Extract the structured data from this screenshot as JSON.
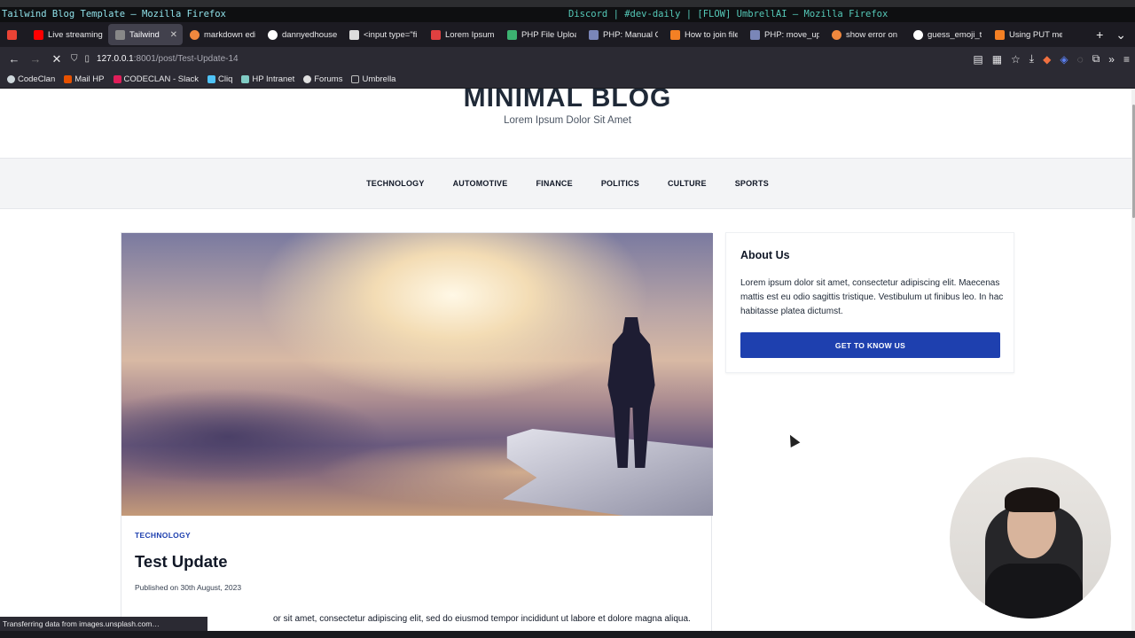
{
  "wm": {
    "left_title": "Tailwind Blog Template — Mozilla Firefox",
    "right_title": "Discord | #dev-daily | [FLOW] UmbrellAI — Mozilla Firefox"
  },
  "tabs": [
    {
      "label": "",
      "color": "#ea4335",
      "icon": "gmail-icon"
    },
    {
      "label": "Live streaming",
      "color": "#ff0000",
      "icon": "youtube-icon"
    },
    {
      "label": "Tailwind Blo",
      "color": "#888888",
      "icon": "page-icon",
      "active": true
    },
    {
      "label": "markdown edi",
      "color": "#f0883e",
      "icon": "site-icon"
    },
    {
      "label": "dannyedhouse",
      "color": "#ffffff",
      "icon": "github-icon"
    },
    {
      "label": "<input type=\"fi",
      "color": "#dddddd",
      "icon": "mdn-icon"
    },
    {
      "label": "Lorem Ipsum",
      "color": "#e04040",
      "icon": "site-icon"
    },
    {
      "label": "PHP File Uploa",
      "color": "#3cb371",
      "icon": "w3-icon"
    },
    {
      "label": "PHP: Manual Q",
      "color": "#7a86b8",
      "icon": "php-icon"
    },
    {
      "label": "How to join file",
      "color": "#f48024",
      "icon": "stackoverflow-icon"
    },
    {
      "label": "PHP: move_up",
      "color": "#7a86b8",
      "icon": "php-icon"
    },
    {
      "label": "show error on",
      "color": "#f0883e",
      "icon": "site-icon"
    },
    {
      "label": "guess_emoji_t",
      "color": "#ffffff",
      "icon": "github-icon"
    },
    {
      "label": "Using PUT met",
      "color": "#f48024",
      "icon": "stackoverflow-icon"
    }
  ],
  "nav": {
    "url_host": "127.0.0.1",
    "url_path": ":8001/post/Test-Update-14"
  },
  "bookmarks": [
    {
      "label": "CodeClan",
      "color": "#cfd8dc",
      "icon": "globe-icon"
    },
    {
      "label": "Mail HP",
      "color": "#e65100",
      "icon": "mail-icon"
    },
    {
      "label": "CODECLAN - Slack",
      "color": "#e01e5a",
      "icon": "slack-icon"
    },
    {
      "label": "Cliq",
      "color": "#4fc3f7",
      "icon": "cliq-icon"
    },
    {
      "label": "HP Intranet",
      "color": "#80cbc4",
      "icon": "intranet-icon"
    },
    {
      "label": "Forums",
      "color": "#e0e0e0",
      "icon": "forums-icon"
    },
    {
      "label": "Umbrella",
      "color": "#bdbdbd",
      "icon": "folder-icon"
    }
  ],
  "site": {
    "title": "MINIMAL BLOG",
    "subtitle": "Lorem Ipsum Dolor Sit Amet",
    "categories": [
      "TECHNOLOGY",
      "AUTOMOTIVE",
      "FINANCE",
      "POLITICS",
      "CULTURE",
      "SPORTS"
    ]
  },
  "post": {
    "category": "TECHNOLOGY",
    "title": "Test Update",
    "meta": "Published on 30th August, 2023",
    "body_visible": "or sit amet, consectetur adipiscing elit, sed do eiusmod tempor incididunt ut labore et dolore magna aliqua."
  },
  "about": {
    "heading": "About Us",
    "text": "Lorem ipsum dolor sit amet, consectetur adipiscing elit. Maecenas mattis est eu odio sagittis tristique. Vestibulum ut finibus leo. In hac habitasse platea dictumst.",
    "button": "GET TO KNOW US"
  },
  "status": "Transferring data from images.unsplash.com…",
  "colors": {
    "accent": "#1e40af",
    "browser_dark": "#2b2a33"
  }
}
